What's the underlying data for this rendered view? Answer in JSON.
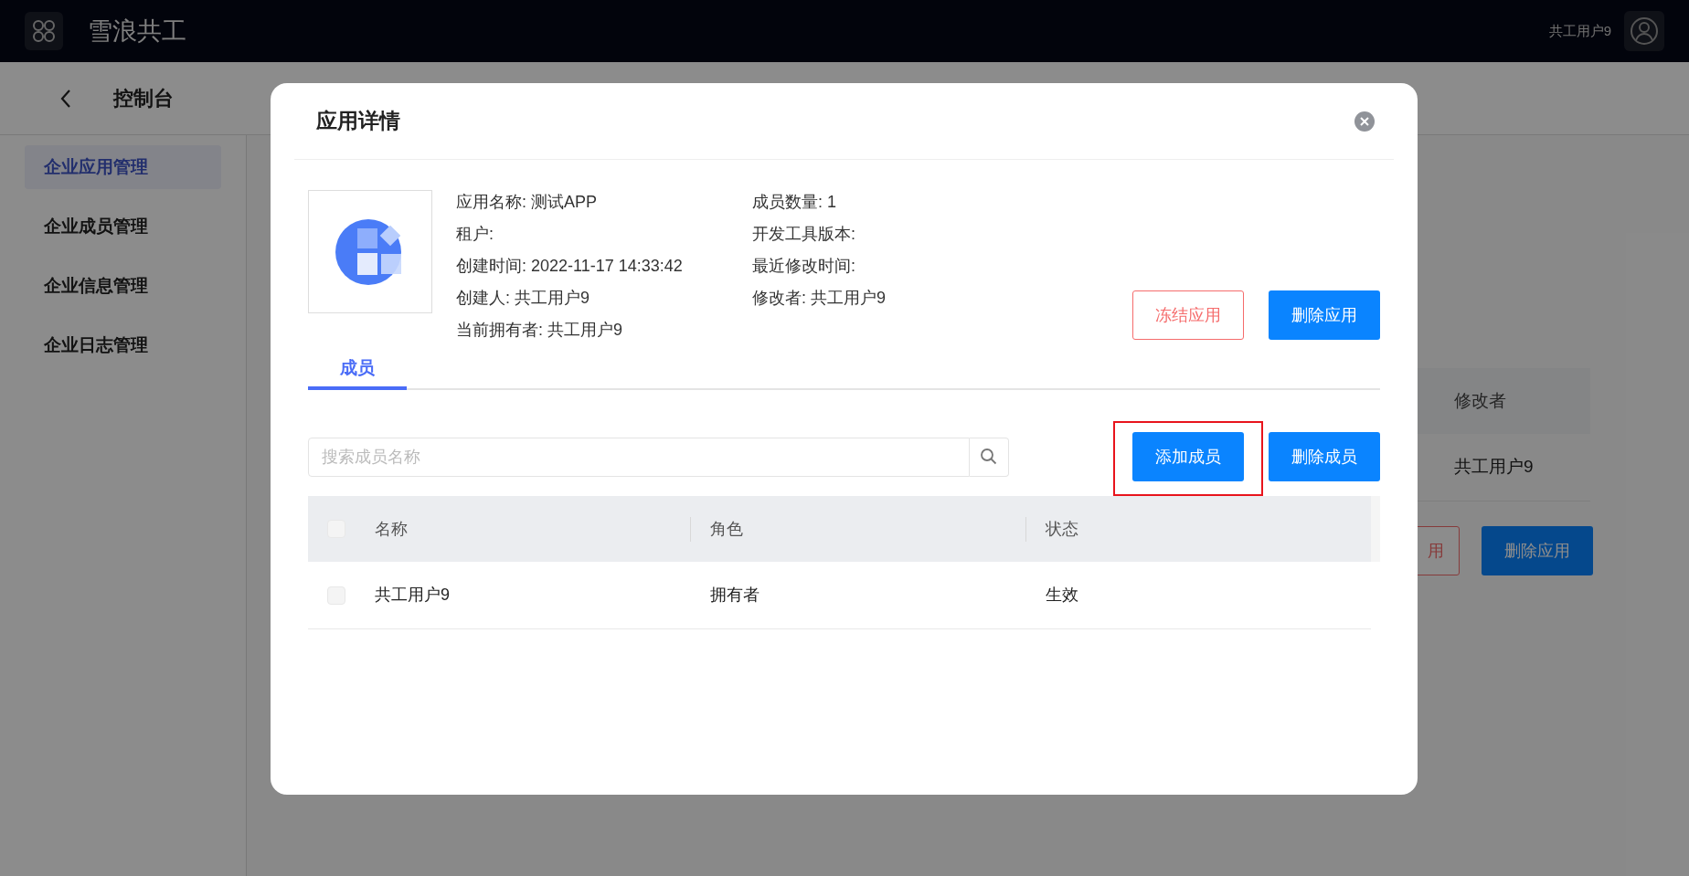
{
  "top_bar": {
    "brand": "雪浪共工",
    "user": "共工用户9"
  },
  "sub_header": {
    "title": "控制台"
  },
  "sidebar": {
    "items": [
      {
        "label": "企业应用管理",
        "selected": true
      },
      {
        "label": "企业成员管理",
        "selected": false
      },
      {
        "label": "企业信息管理",
        "selected": false
      },
      {
        "label": "企业日志管理",
        "selected": false
      }
    ]
  },
  "background_page": {
    "column_header": "修改者",
    "cell": "共工用户9",
    "buttons": [
      {
        "label": "用",
        "kind": "outline"
      },
      {
        "label": "删除应用",
        "kind": "primary"
      }
    ]
  },
  "dialog": {
    "title": "应用详情",
    "info_left": [
      "应用名称: 测试APP",
      "租户:",
      "创建时间: 2022-11-17 14:33:42",
      "创建人: 共工用户9",
      "当前拥有者: 共工用户9"
    ],
    "info_right": [
      "成员数量: 1",
      "开发工具版本:",
      "最近修改时间:",
      "修改者: 共工用户9"
    ],
    "actions": [
      {
        "label": "冻结应用",
        "kind": "outline"
      },
      {
        "label": "删除应用",
        "kind": "primary"
      }
    ],
    "tabs": [
      {
        "label": "成员",
        "selected": true
      }
    ],
    "search": {
      "placeholder": "搜索成员名称"
    },
    "member_actions": [
      {
        "label": "添加成员",
        "kind": "primary",
        "highlighted": true
      },
      {
        "label": "删除成员",
        "kind": "primary",
        "highlighted": false
      }
    ],
    "table": {
      "header_checked": false,
      "columns": [
        "名称",
        "角色",
        "状态"
      ],
      "rows": [
        {
          "cells": [
            "共工用户9",
            "拥有者",
            "生效"
          ],
          "checked": false
        }
      ]
    }
  }
}
